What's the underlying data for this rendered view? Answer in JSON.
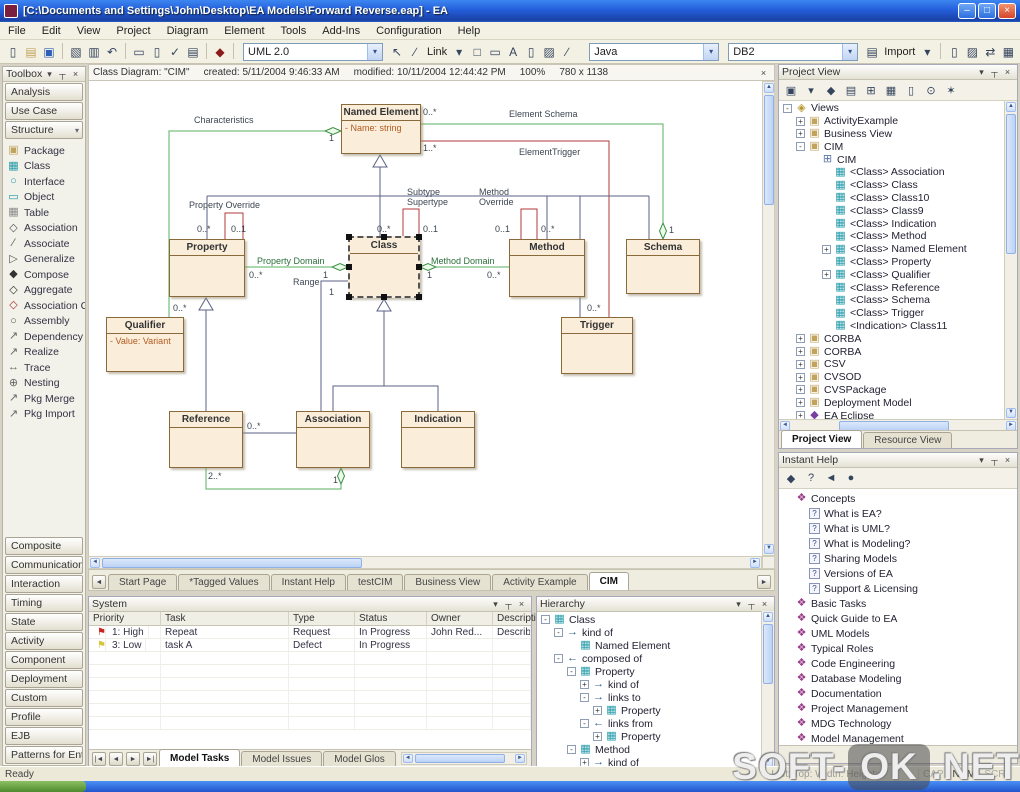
{
  "icons": {
    "caret": "▾",
    "close": "×",
    "pin": "┬",
    "up": "▲",
    "down": "▼",
    "left": "◄",
    "right": "►",
    "first": "|◄",
    "last": "►|",
    "minimize": "–",
    "maximize": "□"
  },
  "window": {
    "title": "[C:\\Documents and Settings\\John\\Desktop\\EA Models\\Forward Reverse.eap] - EA",
    "menus": [
      "File",
      "Edit",
      "View",
      "Project",
      "Diagram",
      "Element",
      "Tools",
      "Add-Ins",
      "Configuration",
      "Help"
    ],
    "toolbar": {
      "main_icons": [
        {
          "name": "new-file-icon",
          "glyph": "▯"
        },
        {
          "name": "open-folder-icon",
          "glyph": "▤"
        },
        {
          "name": "save-icon",
          "glyph": "▣"
        },
        {
          "name": "separator",
          "glyph": ""
        },
        {
          "name": "copy-icon",
          "glyph": "▧"
        },
        {
          "name": "paste-icon",
          "glyph": "▥"
        },
        {
          "name": "undo-icon",
          "glyph": "↶"
        },
        {
          "name": "separator",
          "glyph": ""
        },
        {
          "name": "print-icon",
          "glyph": "▭"
        },
        {
          "name": "print-preview-icon",
          "glyph": "▯"
        },
        {
          "name": "spell-check-icon",
          "glyph": "✓"
        },
        {
          "name": "notes-icon",
          "glyph": "▤"
        },
        {
          "name": "separator",
          "glyph": ""
        },
        {
          "name": "appearance-icon",
          "glyph": "◆"
        },
        {
          "name": "separator",
          "glyph": ""
        }
      ],
      "uml_combo": "UML 2.0",
      "draw_icons": [
        {
          "name": "pointer-icon",
          "glyph": "↖"
        },
        {
          "name": "pen-icon",
          "glyph": "∕"
        },
        {
          "name": "link-label",
          "glyph": "Link"
        },
        {
          "name": "chevron-down-icon",
          "glyph": "▾"
        },
        {
          "name": "rectangle-icon",
          "glyph": "□"
        },
        {
          "name": "note-icon",
          "glyph": "▭"
        },
        {
          "name": "text-icon",
          "glyph": "A"
        },
        {
          "name": "document-icon",
          "glyph": "▯"
        },
        {
          "name": "image-icon",
          "glyph": "▨"
        },
        {
          "name": "line-icon",
          "glyph": "∕"
        }
      ],
      "lang_combo": "Java",
      "db_combo": "DB2",
      "import_icons": [
        {
          "name": "import-icon",
          "glyph": "▤"
        },
        {
          "name": "import-label",
          "glyph": "Import"
        },
        {
          "name": "chevron-down-icon",
          "glyph": "▾"
        },
        {
          "name": "separator",
          "glyph": ""
        },
        {
          "name": "generate-code-icon",
          "glyph": "▯"
        },
        {
          "name": "reverse-engineer-icon",
          "glyph": "▨"
        },
        {
          "name": "sync-icon",
          "glyph": "⇄"
        },
        {
          "name": "grid-icon",
          "glyph": "▦"
        }
      ]
    }
  },
  "toolbox": {
    "title": "Toolbox",
    "sections_top": [
      "Analysis",
      "Use Case"
    ],
    "active_section": "Structure",
    "items": [
      {
        "label": "Package",
        "icon": "package-icon"
      },
      {
        "label": "Class",
        "icon": "class-icon"
      },
      {
        "label": "Interface",
        "icon": "interface-icon"
      },
      {
        "label": "Object",
        "icon": "object-icon"
      },
      {
        "label": "Table",
        "icon": "table-icon"
      },
      {
        "label": "Association",
        "icon": "association-icon"
      },
      {
        "label": "Associate",
        "icon": "associate-icon"
      },
      {
        "label": "Generalize",
        "icon": "generalize-icon"
      },
      {
        "label": "Compose",
        "icon": "compose-icon"
      },
      {
        "label": "Aggregate",
        "icon": "aggregate-icon"
      },
      {
        "label": "Association Cl...",
        "icon": "association-class-icon"
      },
      {
        "label": "Assembly",
        "icon": "assembly-icon"
      },
      {
        "label": "Dependency",
        "icon": "dependency-icon"
      },
      {
        "label": "Realize",
        "icon": "realize-icon"
      },
      {
        "label": "Trace",
        "icon": "trace-icon"
      },
      {
        "label": "Nesting",
        "icon": "nesting-icon"
      },
      {
        "label": "Pkg Merge",
        "icon": "pkg-merge-icon"
      },
      {
        "label": "Pkg Import",
        "icon": "pkg-import-icon"
      }
    ],
    "sections_bottom": [
      "Composite",
      "Communication",
      "Interaction",
      "Timing",
      "State",
      "Activity",
      "Component",
      "Deployment",
      "Custom",
      "Profile",
      "EJB",
      "Patterns for Ente..."
    ]
  },
  "diagram": {
    "header": {
      "title": "Class Diagram: \"CIM\"",
      "created": "created: 5/11/2004 9:46:33 AM",
      "modified": "modified: 10/11/2004 12:44:42 PM",
      "zoom": "100%",
      "size": "780 x 1138"
    },
    "classes": [
      {
        "name": "Named Element",
        "attr": "-  Name:  string"
      },
      {
        "name": "Property",
        "attr": ""
      },
      {
        "name": "Class",
        "attr": ""
      },
      {
        "name": "Method",
        "attr": ""
      },
      {
        "name": "Schema",
        "attr": ""
      },
      {
        "name": "Qualifier",
        "attr": "-  Value:  Variant"
      },
      {
        "name": "Trigger",
        "attr": ""
      },
      {
        "name": "Reference",
        "attr": ""
      },
      {
        "name": "Association",
        "attr": ""
      },
      {
        "name": "Indication",
        "attr": ""
      }
    ],
    "labels": {
      "characteristics": "Characteristics",
      "element_schema": "Element Schema",
      "element_trigger": "ElementTrigger",
      "property_override": "Property Override",
      "subtype": "Subtype",
      "supertype": "Supertype",
      "method_l1": "Method",
      "method_l2": "Override",
      "property_domain": "Property Domain",
      "method_domain": "Method Domain",
      "range": "Range"
    },
    "mults": [
      "0..*",
      "1",
      "1..*",
      "0..*",
      "0..*",
      "0..1",
      "0..*",
      "0..1",
      "0..1",
      "0..*",
      "0..*",
      "1",
      "1",
      "0..*",
      "1",
      "0..*",
      "1",
      "0..*",
      "2..*",
      "1"
    ],
    "tabs": [
      {
        "label": "Start Page"
      },
      {
        "label": "*Tagged Values"
      },
      {
        "label": "Instant Help"
      },
      {
        "label": "testCIM"
      },
      {
        "label": "Business View"
      },
      {
        "label": "Activity Example"
      },
      {
        "label": "CIM",
        "active": true
      }
    ]
  },
  "system": {
    "title": "System",
    "columns": [
      "Priority",
      "Task",
      "Type",
      "Status",
      "Owner",
      "Description"
    ],
    "rows": [
      {
        "flag": "red-flag-icon",
        "priority": "1: High",
        "task": "Repeat",
        "type": "Request",
        "status": "In Progress",
        "owner": "John Red...",
        "description": "Describe"
      },
      {
        "flag": "yellow-flag-icon",
        "priority": "3: Low",
        "task": "task A",
        "type": "Defect",
        "status": "In Progress",
        "owner": "",
        "description": ""
      }
    ],
    "tabs": [
      {
        "label": "Model Tasks",
        "active": true
      },
      {
        "label": "Model Issues"
      },
      {
        "label": "Model Glos"
      }
    ]
  },
  "hierarchy": {
    "title": "Hierarchy",
    "tree": [
      {
        "label": "Class",
        "icon": "class-icon",
        "expand": "-",
        "level": 0
      },
      {
        "label": "kind of",
        "icon": "arrow-right-icon",
        "expand": "-",
        "level": 1
      },
      {
        "label": "Named Element",
        "icon": "class-icon",
        "expand": "",
        "level": 2
      },
      {
        "label": "composed of",
        "icon": "arrow-left-icon",
        "expand": "-",
        "level": 1
      },
      {
        "label": "Property",
        "icon": "class-icon",
        "expand": "-",
        "level": 2
      },
      {
        "label": "kind of",
        "icon": "arrow-right-icon",
        "expand": "+",
        "level": 3
      },
      {
        "label": "links to",
        "icon": "arrow-right-icon",
        "expand": "-",
        "level": 3
      },
      {
        "label": "Property",
        "icon": "class-icon",
        "expand": "+",
        "level": 4
      },
      {
        "label": "links from",
        "icon": "arrow-left-icon",
        "expand": "-",
        "level": 3
      },
      {
        "label": "Property",
        "icon": "class-icon",
        "expand": "+",
        "level": 4
      },
      {
        "label": "Method",
        "icon": "class-icon",
        "expand": "-",
        "level": 2
      },
      {
        "label": "kind of",
        "icon": "arrow-right-icon",
        "expand": "+",
        "level": 3
      }
    ]
  },
  "project": {
    "title": "Project View",
    "toolbar": [
      {
        "name": "new-model-icon",
        "glyph": "▣"
      },
      {
        "name": "chevron-down-icon",
        "glyph": "▾"
      },
      {
        "name": "open-model-icon",
        "glyph": "◆"
      },
      {
        "name": "new-package-icon",
        "glyph": "▤"
      },
      {
        "name": "new-diagram-icon",
        "glyph": "⊞"
      },
      {
        "name": "new-element-icon",
        "glyph": "▦"
      },
      {
        "name": "documentation-icon",
        "glyph": "▯"
      },
      {
        "name": "search-icon",
        "glyph": "⊙"
      },
      {
        "name": "settings-icon",
        "glyph": "✶"
      }
    ],
    "tree": [
      {
        "label": "Views",
        "icon": "views-icon",
        "expand": "-",
        "level": 0
      },
      {
        "label": "ActivityExample",
        "icon": "package-icon",
        "expand": "+",
        "level": 1
      },
      {
        "label": "Business View",
        "icon": "package-icon",
        "expand": "+",
        "level": 1
      },
      {
        "label": "CIM",
        "icon": "package-icon",
        "expand": "-",
        "level": 1
      },
      {
        "label": "CIM",
        "icon": "diagram-icon",
        "expand": "",
        "level": 2
      },
      {
        "label": "<Class> Association",
        "icon": "class-icon",
        "expand": "",
        "level": 3
      },
      {
        "label": "<Class> Class",
        "icon": "class-icon",
        "expand": "",
        "level": 3
      },
      {
        "label": "<Class> Class10",
        "icon": "class-icon",
        "expand": "",
        "level": 3
      },
      {
        "label": "<Class> Class9",
        "icon": "class-icon",
        "expand": "",
        "level": 3
      },
      {
        "label": "<Class> Indication",
        "icon": "class-icon",
        "expand": "",
        "level": 3
      },
      {
        "label": "<Class> Method",
        "icon": "class-icon",
        "expand": "",
        "level": 3
      },
      {
        "label": "<Class> Named Element",
        "icon": "class-icon",
        "expand": "+",
        "level": 3
      },
      {
        "label": "<Class> Property",
        "icon": "class-icon",
        "expand": "",
        "level": 3
      },
      {
        "label": "<Class> Qualifier",
        "icon": "class-icon",
        "expand": "+",
        "level": 3
      },
      {
        "label": "<Class> Reference",
        "icon": "class-icon",
        "expand": "",
        "level": 3
      },
      {
        "label": "<Class> Schema",
        "icon": "class-icon",
        "expand": "",
        "level": 3
      },
      {
        "label": "<Class> Trigger",
        "icon": "class-icon",
        "expand": "",
        "level": 3
      },
      {
        "label": "<Indication> Class11",
        "icon": "class-icon",
        "expand": "",
        "level": 3
      },
      {
        "label": "CORBA",
        "icon": "package-icon",
        "expand": "+",
        "level": 1
      },
      {
        "label": "CORBA",
        "icon": "package-icon",
        "expand": "+",
        "level": 1
      },
      {
        "label": "CSV",
        "icon": "package-icon",
        "expand": "+",
        "level": 1
      },
      {
        "label": "CVSOD",
        "icon": "package-icon",
        "expand": "+",
        "level": 1
      },
      {
        "label": "CVSPackage",
        "icon": "package-icon",
        "expand": "+",
        "level": 1
      },
      {
        "label": "Deployment Model",
        "icon": "package-icon",
        "expand": "+",
        "level": 1
      },
      {
        "label": "EA Eclipse",
        "icon": "addin-icon",
        "expand": "+",
        "level": 1
      }
    ],
    "tabs": [
      {
        "label": "Project View",
        "active": true
      },
      {
        "label": "Resource View"
      }
    ]
  },
  "help": {
    "title": "Instant Help",
    "toolbar": [
      {
        "name": "help-book-icon",
        "glyph": "◆"
      },
      {
        "name": "help-topic-icon",
        "glyph": "?"
      },
      {
        "name": "back-icon",
        "glyph": "◄"
      },
      {
        "name": "web-icon",
        "glyph": "●"
      }
    ],
    "tree": [
      {
        "label": "Concepts",
        "icon": "open-book-icon",
        "expand": "",
        "level": 0
      },
      {
        "label": "What is EA?",
        "icon": "help-page-icon",
        "expand": "",
        "level": 1
      },
      {
        "label": "What is UML?",
        "icon": "help-page-icon",
        "expand": "",
        "level": 1
      },
      {
        "label": "What is Modeling?",
        "icon": "help-page-icon",
        "expand": "",
        "level": 1
      },
      {
        "label": "Sharing Models",
        "icon": "help-page-icon",
        "expand": "",
        "level": 1
      },
      {
        "label": "Versions of EA",
        "icon": "help-page-icon",
        "expand": "",
        "level": 1
      },
      {
        "label": "Support & Licensing",
        "icon": "help-page-icon",
        "expand": "",
        "level": 1
      },
      {
        "label": "Basic Tasks",
        "icon": "book-icon",
        "expand": "",
        "level": 0
      },
      {
        "label": "Quick Guide to EA",
        "icon": "book-icon",
        "expand": "",
        "level": 0
      },
      {
        "label": "UML Models",
        "icon": "book-icon",
        "expand": "",
        "level": 0
      },
      {
        "label": "Typical Roles",
        "icon": "book-icon",
        "expand": "",
        "level": 0
      },
      {
        "label": "Code Engineering",
        "icon": "book-icon",
        "expand": "",
        "level": 0
      },
      {
        "label": "Database Modeling",
        "icon": "book-icon",
        "expand": "",
        "level": 0
      },
      {
        "label": "Documentation",
        "icon": "book-icon",
        "expand": "",
        "level": 0
      },
      {
        "label": "Project Management",
        "icon": "book-icon",
        "expand": "",
        "level": 0
      },
      {
        "label": "MDG Technology",
        "icon": "book-icon",
        "expand": "",
        "level": 0
      },
      {
        "label": "Model Management",
        "icon": "book-icon",
        "expand": "",
        "level": 0
      }
    ]
  },
  "status_bar": {
    "ready": "Ready",
    "position_info": "Left:    Top:    Width:    Height:",
    "cap": "CAP",
    "num": "NUM",
    "scrl": "SCRL"
  },
  "watermark": {
    "part1": "SOFT-",
    "part2": "OK",
    "part3": ".NET"
  }
}
